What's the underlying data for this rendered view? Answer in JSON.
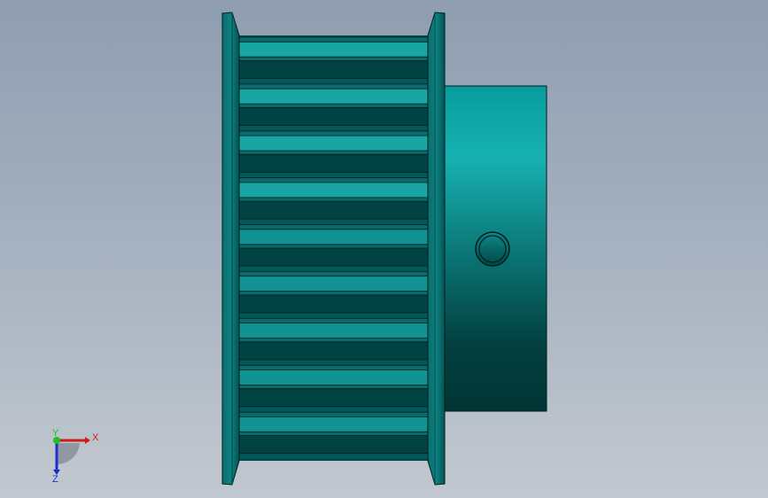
{
  "viewport": {
    "background_top": "#8f9db0",
    "background_bottom": "#c2c8cf"
  },
  "model": {
    "part_type": "timing-belt-pulley",
    "colors": {
      "flange": "#0b7777",
      "flange_edge": "#034a4a",
      "tooth_light": "#1aa5a5",
      "tooth_dark": "#014343",
      "hub_light": "#17b1b1",
      "hub_dark": "#013d3d",
      "outline": "#001e1e"
    }
  },
  "triad": {
    "x_label": "X",
    "y_label": "Y",
    "z_label": "Z",
    "x_color": "#d11a1a",
    "y_color": "#1fbf1f",
    "z_color": "#1a2fd1"
  }
}
